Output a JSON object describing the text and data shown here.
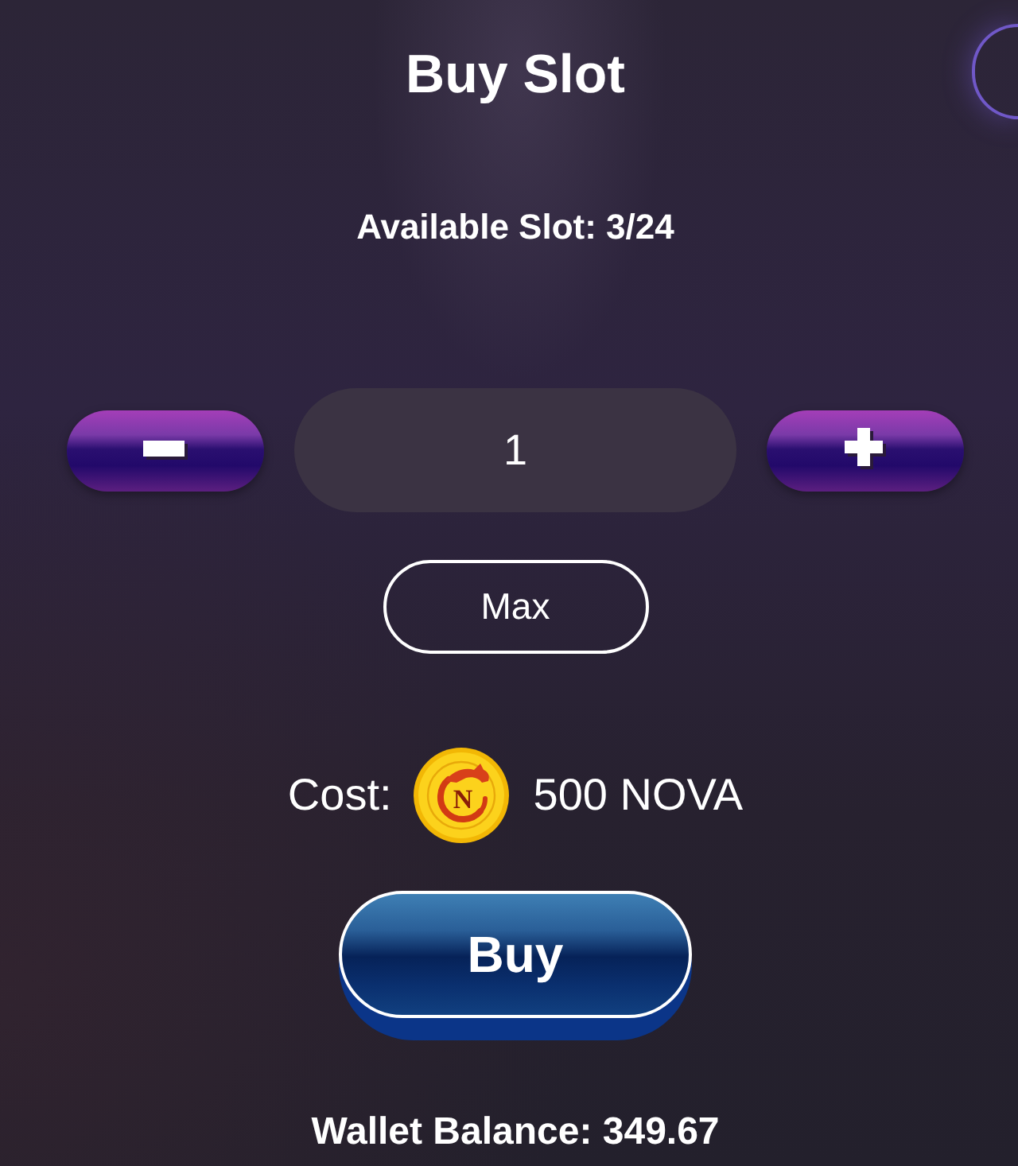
{
  "title": "Buy Slot",
  "available_slot": "Available Slot: 3/24",
  "quantity": {
    "value": "1"
  },
  "max_button": "Max",
  "cost": {
    "label": "Cost:",
    "coin_letter": "N",
    "amount": "500 NOVA"
  },
  "buy_button": "Buy",
  "wallet_balance": "Wallet Balance: 349.67"
}
